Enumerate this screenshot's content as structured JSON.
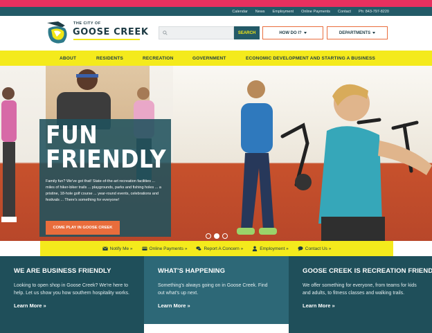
{
  "utility_links": [
    "Calendar",
    "News",
    "Employment",
    "Online Payments",
    "Contact",
    "Ph: 843-797-8220"
  ],
  "brand": {
    "small": "THE CITY OF",
    "name": "GOOSE CREEK"
  },
  "search": {
    "placeholder": "",
    "button_label": "SEARCH"
  },
  "header_buttons": {
    "how_do_i": "HOW DO I?",
    "departments": "DEPARTMENTS"
  },
  "main_nav": [
    "ABOUT",
    "RESIDENTS",
    "RECREATION",
    "GOVERNMENT",
    "ECONOMIC DEVELOPMENT AND STARTING A BUSINESS"
  ],
  "hero": {
    "title_line1": "FUN",
    "title_line2": "FRIENDLY",
    "text": "Family fun? We've got that! State-of-the-art recreation facilities ... miles of hiker-biker trails ... playgrounds, parks and fishing holes ... a pristine, 18-hole golf course ... year-round events, celebrations and festivals ... There's something for everyone!",
    "cta": "COME PLAY IN GOOSE CREEK",
    "slides": 3,
    "active_slide": 2
  },
  "quick_links": [
    {
      "label": "Notify Me »",
      "icon": "envelope-icon"
    },
    {
      "label": "Online Payments »",
      "icon": "credit-card-icon"
    },
    {
      "label": "Report A Concern »",
      "icon": "chat-icon"
    },
    {
      "label": "Employment »",
      "icon": "person-icon"
    },
    {
      "label": "Contact Us »",
      "icon": "speech-bubble-icon"
    }
  ],
  "panels": [
    {
      "title": "WE ARE BUSINESS FRIENDLY",
      "text": "Looking to open shop in Goose Creek? We're here to help. Let us show you how southern hospitality works.",
      "link": "Learn More »"
    },
    {
      "title": "WHAT'S HAPPENING",
      "text": "Something's always going on in Goose Creek. Find out what's up next.",
      "link": "Learn More »"
    },
    {
      "title": "GOOSE CREEK IS RECREATION FRIENDLY",
      "text": "We offer something for everyone, from teams for kids and adults, to fitness classes and walking trails.",
      "link": "Learn More »"
    }
  ],
  "colors": {
    "teal": "#235a67",
    "yellow": "#f4ea1c",
    "orange": "#e96d3c",
    "pink": "#e8305f"
  }
}
